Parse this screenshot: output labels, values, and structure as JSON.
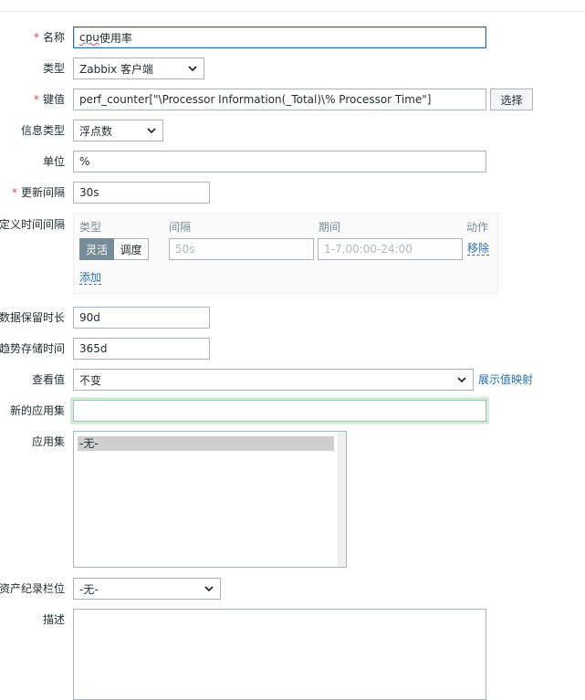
{
  "form": {
    "name": {
      "label": "名称",
      "required": true,
      "value_misspelled": "cpu",
      "value_rest": "使用率"
    },
    "type": {
      "label": "类型",
      "value": "Zabbix 客户端"
    },
    "key": {
      "label": "键值",
      "required": true,
      "value": "perf_counter[\"\\Processor Information(_Total)\\% Processor Time\"]",
      "select_button": "选择"
    },
    "info_type": {
      "label": "信息类型",
      "value": "浮点数"
    },
    "units": {
      "label": "单位",
      "value": "%"
    },
    "update_interval": {
      "label": "更新间隔",
      "required": true,
      "value": "30s"
    },
    "custom_intervals": {
      "label": "定义时间间隔",
      "columns": {
        "type": "类型",
        "interval": "间隔",
        "period": "期间",
        "action": "动作"
      },
      "row": {
        "flexible": "灵活",
        "scheduling": "调度",
        "interval_placeholder": "50s",
        "period_placeholder": "1-7,00:00-24:00",
        "remove": "移除"
      },
      "add": "添加"
    },
    "history": {
      "label": "数据保留时长",
      "value": "90d"
    },
    "trends": {
      "label": "趋势存储时间",
      "value": "365d"
    },
    "show_value": {
      "label": "查看值",
      "value": "不变",
      "link": "展示值映射"
    },
    "new_application": {
      "label": "新的应用集",
      "value": ""
    },
    "applications": {
      "label": "应用集",
      "options": [
        "-无-"
      ]
    },
    "inventory": {
      "label": "资产纪录栏位",
      "value": "-无-"
    },
    "description": {
      "label": "描述",
      "value": ""
    }
  },
  "colors": {
    "accent": "#2b6fab",
    "required": "#d64e4e",
    "segment_active": "#768d99"
  }
}
